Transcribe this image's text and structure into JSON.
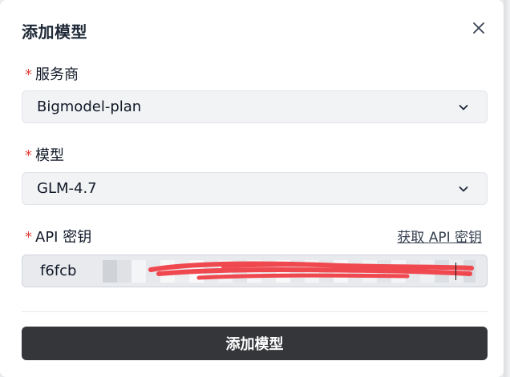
{
  "dialog": {
    "title": "添加模型"
  },
  "fields": {
    "provider": {
      "required_mark": "*",
      "label": "服务商",
      "value": "Bigmodel-plan"
    },
    "model": {
      "required_mark": "*",
      "label": "模型",
      "value": "GLM-4.7"
    },
    "api_key": {
      "required_mark": "*",
      "label": "API 密钥",
      "value": "f6fcb",
      "get_key_link": "获取 API 密钥"
    }
  },
  "actions": {
    "submit_label": "添加模型"
  },
  "icons": {
    "close": "close-icon",
    "chevron": "chevron-down-icon"
  },
  "colors": {
    "required": "#e0403b",
    "button_bg": "#34363a",
    "redaction": "#f0484f"
  }
}
